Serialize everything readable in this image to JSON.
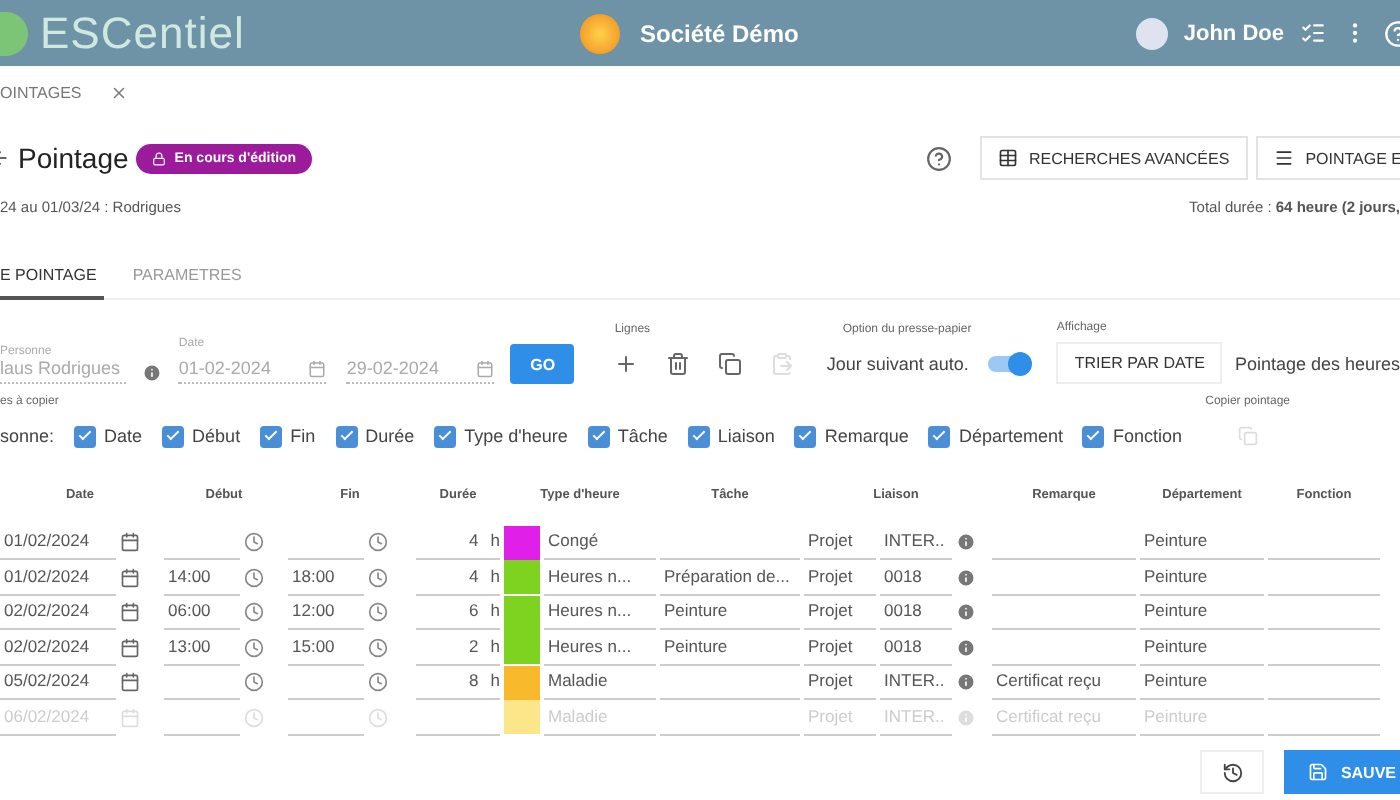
{
  "app_bar": {
    "brand": "ESCentiel",
    "company": "Société Démo",
    "user": "John Doe"
  },
  "open_tab": {
    "label": "OINTAGES"
  },
  "page": {
    "title": "Pointage",
    "status_badge": "En cours d'édition",
    "subtitle": "24 au 01/03/24 : Rodrigues",
    "total": "Total durée : **64 heure (2 jours,**"
  },
  "actions": [
    {
      "kind": "table",
      "label": "RECHERCHES AVANCÉES"
    },
    {
      "kind": "menu",
      "label": "POINTAGE E"
    }
  ],
  "tabs": [
    {
      "label": "E POINTAGE",
      "selected": true
    },
    {
      "label": "PARAMETRES",
      "selected": false
    }
  ],
  "filters": {
    "person_label": "Personne",
    "person_value": "laus Rodrigues",
    "date_label": "Date",
    "date_from": "01-02-2024",
    "date_to": "29-02-2024",
    "go": "GO"
  },
  "lines": {
    "label": "Lignes",
    "tools": [
      {
        "kind": "add",
        "disabled": false
      },
      {
        "kind": "delete",
        "disabled": false
      },
      {
        "kind": "copy",
        "disabled": false
      },
      {
        "kind": "paste",
        "disabled": true
      }
    ]
  },
  "clipboard": {
    "label": "Option du presse-papier",
    "toggle_label": "Jour suivant auto.",
    "on": true
  },
  "display": {
    "label": "Affichage",
    "sort_button": "TRIER PAR DATE",
    "mode": "Pointage des heures"
  },
  "copy_fields": {
    "label": "es à copier",
    "first": "sonne:",
    "options": [
      {
        "label": "Date",
        "checked": true
      },
      {
        "label": "Début",
        "checked": true
      },
      {
        "label": "Fin",
        "checked": true
      },
      {
        "label": "Durée",
        "checked": true
      },
      {
        "label": "Type d'heure",
        "checked": true
      },
      {
        "label": "Tâche",
        "checked": true
      },
      {
        "label": "Liaison",
        "checked": true
      },
      {
        "label": "Remarque",
        "checked": true
      },
      {
        "label": "Département",
        "checked": true
      },
      {
        "label": "Fonction",
        "checked": true
      }
    ]
  },
  "copy_timesheet": {
    "label": "Copier pointage"
  },
  "table": {
    "columns": [
      "Date",
      "Début",
      "Fin",
      "Durée",
      "Type d'heure",
      "Tâche",
      "Liaison",
      "Remarque",
      "Département",
      "Fonction"
    ],
    "rows": [
      {
        "date": "01/02/2024",
        "start": "",
        "end": "",
        "duration": "4",
        "unit": "h",
        "type": "Congé",
        "color": "#e020e8",
        "task": "",
        "link_type": "Projet",
        "link": "INTER..",
        "remark": "",
        "department": "Peinture",
        "faded": false
      },
      {
        "date": "01/02/2024",
        "start": "14:00",
        "end": "18:00",
        "duration": "4",
        "unit": "h",
        "type": "Heures n...",
        "color": "#7ed321",
        "task": "Préparation de...",
        "link_type": "Projet",
        "link": "0018",
        "remark": "",
        "department": "Peinture",
        "faded": false
      },
      {
        "date": "02/02/2024",
        "start": "06:00",
        "end": "12:00",
        "duration": "6",
        "unit": "h",
        "type": "Heures n...",
        "color": "#7ed321",
        "task": "Peinture",
        "link_type": "Projet",
        "link": "0018",
        "remark": "",
        "department": "Peinture",
        "faded": false
      },
      {
        "date": "02/02/2024",
        "start": "13:00",
        "end": "15:00",
        "duration": "2",
        "unit": "h",
        "type": "Heures n...",
        "color": "#7ed321",
        "task": "Peinture",
        "link_type": "Projet",
        "link": "0018",
        "remark": "",
        "department": "Peinture",
        "faded": false
      },
      {
        "date": "05/02/2024",
        "start": "",
        "end": "",
        "duration": "8",
        "unit": "h",
        "type": "Maladie",
        "color": "#f9b92c",
        "task": "",
        "link_type": "Projet",
        "link": "INTER..",
        "remark": "Certificat reçu",
        "department": "Peinture",
        "faded": false
      },
      {
        "date": "06/02/2024",
        "start": "",
        "end": "",
        "duration": "",
        "unit": "",
        "type": "Maladie",
        "color": "#fde68a",
        "task": "",
        "link_type": "Projet",
        "link": "INTER..",
        "remark": "Certificat reçu",
        "department": "Peinture",
        "faded": true
      }
    ]
  },
  "footer": {
    "save": "SAUVE"
  }
}
